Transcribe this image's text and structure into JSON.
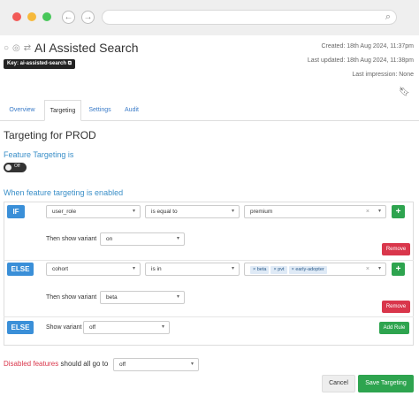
{
  "browser": {
    "back_icon": "←",
    "forward_icon": "→",
    "search_icon": "⌕"
  },
  "header": {
    "title": "AI Assisted Search",
    "key_badge": "Key: ai-assisted-search",
    "created": "Created: 18th Aug 2024, 11:37pm",
    "last_updated": "Last updated: 18th Aug 2024, 11:38pm",
    "last_impression": "Last impression: None",
    "status_icons": [
      "○",
      "◎",
      "⇄"
    ]
  },
  "tabs": [
    {
      "label": "Overview"
    },
    {
      "label": "Targeting"
    },
    {
      "label": "Settings"
    },
    {
      "label": "Audit"
    }
  ],
  "section_title": "Targeting for PROD",
  "feature_targeting_label": "Feature Targeting is",
  "toggle_text": "Off",
  "when_enabled_label": "When feature targeting is enabled",
  "rules": {
    "if": {
      "pill": "IF",
      "attribute": "user_role",
      "operator": "is equal to",
      "value": "premium",
      "then_label": "Then show variant",
      "variant": "on",
      "remove_label": "Remove"
    },
    "else_if": {
      "pill": "ELSE",
      "attribute": "cohort",
      "operator": "is in",
      "tags": [
        "beta",
        "pvt",
        "early-adopter"
      ],
      "then_label": "Then show variant",
      "variant": "beta",
      "remove_label": "Remove"
    },
    "else": {
      "pill": "ELSE",
      "show_label": "Show variant",
      "variant": "off",
      "add_rule_label": "Add Rule"
    }
  },
  "disabled": {
    "prefix": "Disabled features",
    "suffix": " should all go to",
    "value": "off"
  },
  "footer": {
    "cancel_label": "Cancel",
    "save_label": "Save Targeting"
  },
  "colors": {
    "accent_blue": "#3a8fd8",
    "green": "#2ea44f",
    "red": "#d9364b"
  }
}
